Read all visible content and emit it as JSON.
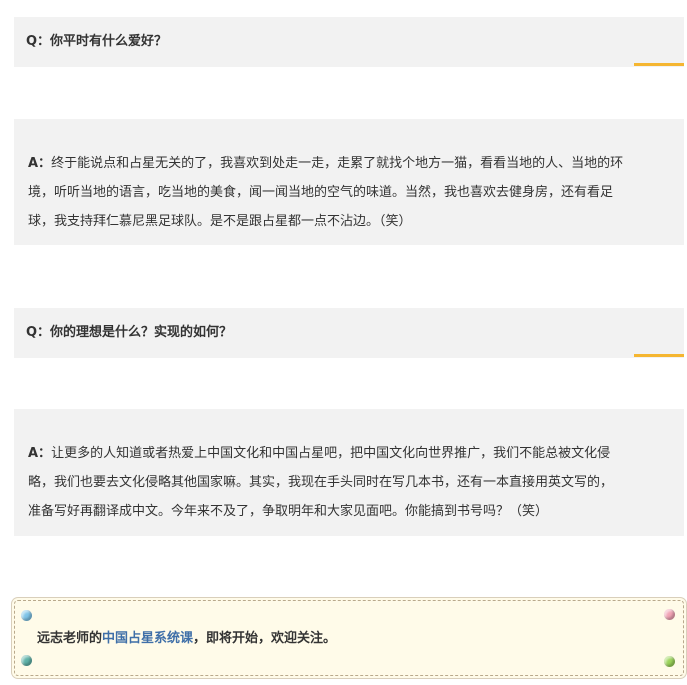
{
  "qa": [
    {
      "question": "Q：你平时有什么爱好？",
      "answer_label": "A：",
      "answer_lines": [
        "终于能说点和占星无关的了，我喜欢到处走一走，走累了就找个地方一猫，看看当地的人、当地的环",
        "境，听听当地的语言，吃当地的美食，闻一闻当地的空气的味道。当然，我也喜欢去健身房，还有看足",
        "球，我支持拜仁慕尼黑足球队。是不是跟占星都一点不沾边。（笑）"
      ]
    },
    {
      "question": "Q：你的理想是什么？实现的如何？",
      "answer_label": "A：",
      "answer_lines": [
        "让更多的人知道或者热爱上中国文化和中国占星吧，把中国文化向世界推广，我们不能总被文化侵",
        "略，我们也要去文化侵略其他国家嘛。其实，我现在手头同时在写几本书，还有一本直接用英文写的，",
        "准备写好再翻译成中文。今年来不及了，争取明年和大家见面吧。你能搞到书号吗？（笑）"
      ]
    }
  ],
  "notice": {
    "prefix": "远志老师的",
    "link": "中国占星系统课",
    "suffix": "，即将开始，欢迎关注。"
  },
  "colors": {
    "accent": "#f5b631",
    "panel": "#f2f2f2",
    "link": "#3f6fa8",
    "notice_bg": "#fffbe9",
    "pin_blue": "#7fc4e8",
    "pin_pink": "#f1a3b5",
    "pin_green": "#9bd35a",
    "pin_teal": "#5fb2a8"
  }
}
